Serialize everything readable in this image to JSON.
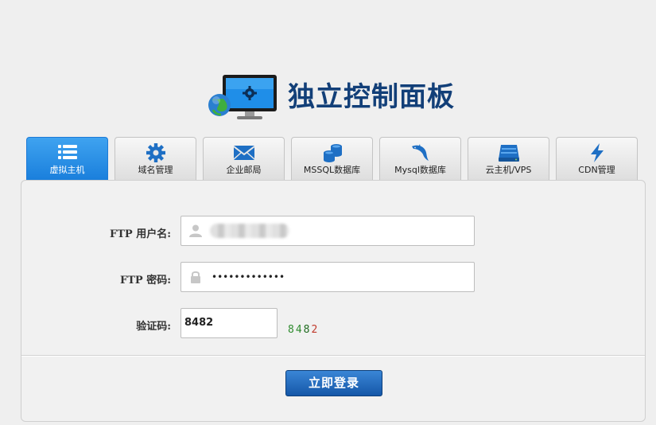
{
  "header": {
    "title": "独立控制面板",
    "logo_icon": "monitor-globe-gear-icon"
  },
  "tabs": [
    {
      "label": "虚拟主机",
      "icon": "list-icon",
      "active": true
    },
    {
      "label": "域名管理",
      "icon": "gear-icon",
      "active": false
    },
    {
      "label": "企业邮局",
      "icon": "envelope-icon",
      "active": false
    },
    {
      "label": "MSSQL数据库",
      "icon": "database-icon",
      "active": false
    },
    {
      "label": "Mysql数据库",
      "icon": "dolphin-icon",
      "active": false
    },
    {
      "label": "云主机/VPS",
      "icon": "server-icon",
      "active": false
    },
    {
      "label": "CDN管理",
      "icon": "lightning-icon",
      "active": false
    }
  ],
  "form": {
    "username_label": "FTP 用户名:",
    "password_label": "FTP 密码:",
    "password_value": "•••••••••••••",
    "captcha_label": "验证码:",
    "captcha_value": "8482",
    "captcha_image": [
      "8",
      "4",
      "8",
      "2"
    ],
    "submit_label": "立即登录"
  },
  "colors": {
    "accent": "#1a7fdc",
    "title": "#123f78",
    "button": "#1557a8"
  }
}
